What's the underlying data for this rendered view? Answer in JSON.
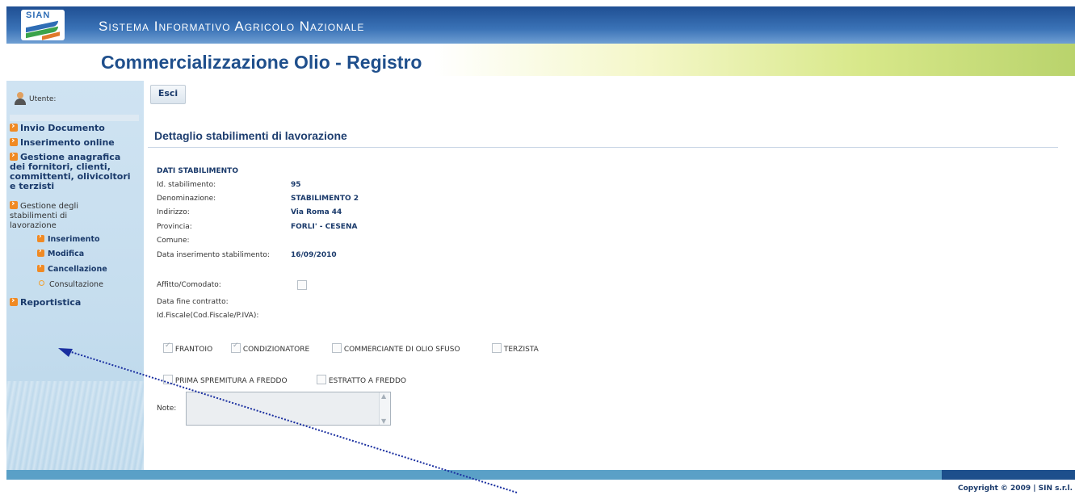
{
  "header": {
    "logo_text": "SIAN",
    "app_name": "Sistema Informativo Agricolo Nazionale",
    "page_title": "Commercializzazione Olio - Registro"
  },
  "sidebar": {
    "user_label": "Utente:",
    "items": [
      {
        "label": "Invio Documento"
      },
      {
        "label": "Inserimento online"
      },
      {
        "label": "Gestione anagrafica dei fornitori, clienti, committenti, olivicoltori e terzisti"
      },
      {
        "label": "Gestione degli stabilimenti di lavorazione"
      },
      {
        "label": "Reportistica"
      }
    ],
    "subitems": [
      {
        "label": "Inserimento"
      },
      {
        "label": "Modifica"
      },
      {
        "label": "Cancellazione"
      },
      {
        "label": "Consultazione"
      }
    ]
  },
  "toolbar": {
    "exit_label": "Esci"
  },
  "detail": {
    "title": "Dettaglio stabilimenti di lavorazione",
    "section": "DATI STABILIMENTO",
    "fields": [
      {
        "label": "Id. stabilimento:",
        "value": "95"
      },
      {
        "label": "Denominazione:",
        "value": "STABILIMENTO 2"
      },
      {
        "label": "Indirizzo:",
        "value": "Via Roma 44"
      },
      {
        "label": "Provincia:",
        "value": "FORLI' - CESENA"
      },
      {
        "label": "Comune:",
        "value": ""
      },
      {
        "label": "Data inserimento stabilimento:",
        "value": "16/09/2010"
      }
    ],
    "rent_label": "Affitto/Comodato:",
    "contract_end_label": "Data fine contratto:",
    "fiscal_id_label": "Id.Fiscale(Cod.Fiscale/P.IVA):",
    "activities": [
      {
        "label": "FRANTOIO",
        "checked": true
      },
      {
        "label": "CONDIZIONATORE",
        "checked": true
      },
      {
        "label": "COMMERCIANTE DI OLIO SFUSO",
        "checked": false
      },
      {
        "label": "TERZISTA",
        "checked": false
      }
    ],
    "extraction": [
      {
        "label": "PRIMA SPREMITURA A FREDDO",
        "checked": false
      },
      {
        "label": "ESTRATTO A FREDDO",
        "checked": false
      }
    ],
    "notes_label": "Note:",
    "notes_value": ""
  },
  "footer": {
    "copyright": "Copyright © 2009 | SIN s.r.l."
  }
}
